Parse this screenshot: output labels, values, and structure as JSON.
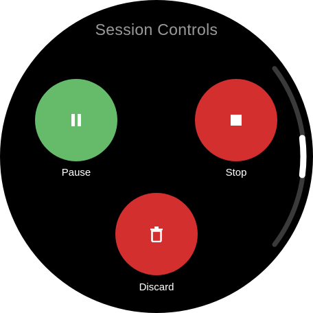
{
  "title": "Session Controls",
  "controls": {
    "pause": {
      "label": "Pause",
      "color": "#66bb6a",
      "icon": "pause-icon"
    },
    "stop": {
      "label": "Stop",
      "color": "#d32f2f",
      "icon": "stop-icon"
    },
    "discard": {
      "label": "Discard",
      "color": "#d32f2f",
      "icon": "trash-icon"
    }
  },
  "scrollbar": {
    "track_color": "#3a3a3a",
    "thumb_color": "#ffffff"
  }
}
